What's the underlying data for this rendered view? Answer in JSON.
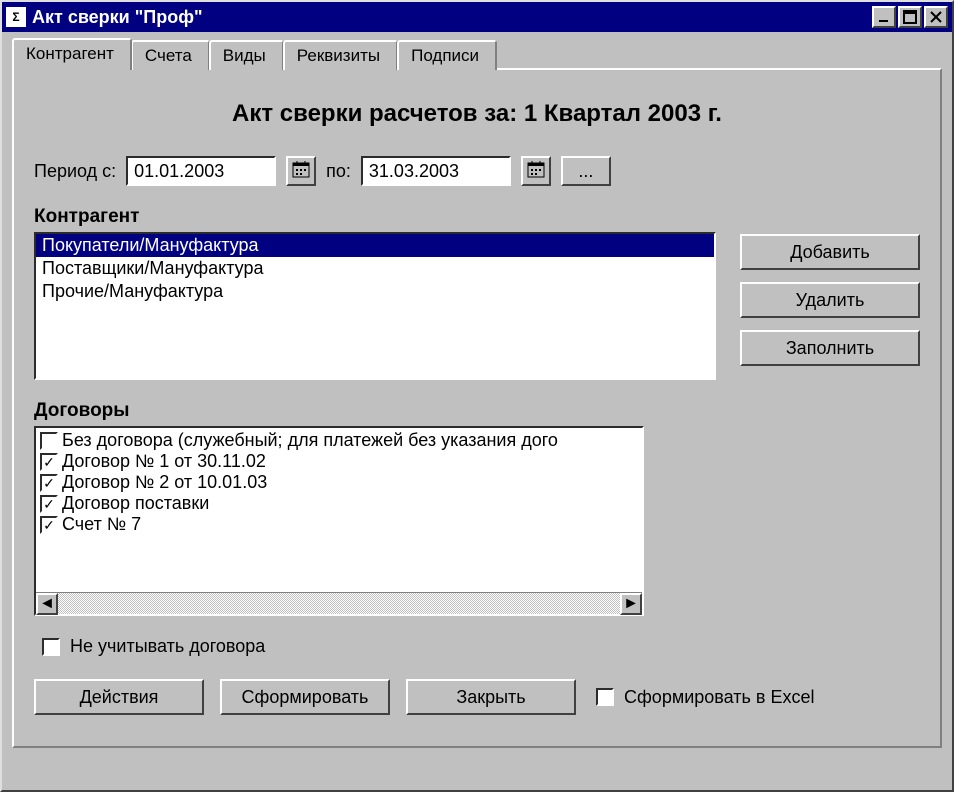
{
  "window": {
    "title": "Акт сверки \"Проф\""
  },
  "tabs": [
    {
      "label": "Контрагент",
      "active": true
    },
    {
      "label": "Счета",
      "active": false
    },
    {
      "label": "Виды",
      "active": false
    },
    {
      "label": "Реквизиты",
      "active": false
    },
    {
      "label": "Подписи",
      "active": false
    }
  ],
  "heading": "Акт сверки расчетов за: 1 Квартал 2003 г.",
  "period": {
    "from_label": "Период с:",
    "to_label": "по:",
    "from": "01.01.2003",
    "to": "31.03.2003",
    "browse_label": "..."
  },
  "counterparty": {
    "group_label": "Контрагент",
    "items": [
      {
        "text": "Покупатели/Мануфактура",
        "selected": true
      },
      {
        "text": "Поставщики/Мануфактура",
        "selected": false
      },
      {
        "text": "Прочие/Мануфактура",
        "selected": false
      }
    ],
    "buttons": {
      "add": "Добавить",
      "delete": "Удалить",
      "fill": "Заполнить"
    }
  },
  "contracts": {
    "group_label": "Договоры",
    "items": [
      {
        "text": "Без договора (служебный; для платежей без указания дого",
        "checked": false
      },
      {
        "text": "Договор № 1 от 30.11.02",
        "checked": true
      },
      {
        "text": "Договор № 2 от 10.01.03",
        "checked": true
      },
      {
        "text": "Договор поставки",
        "checked": true
      },
      {
        "text": "Счет № 7",
        "checked": true
      }
    ]
  },
  "ignore_contracts_label": "Не учитывать договора",
  "actions": {
    "actions_btn": "Действия",
    "form_btn": "Сформировать",
    "close_btn": "Закрыть",
    "excel_label": "Сформировать в Excel"
  }
}
